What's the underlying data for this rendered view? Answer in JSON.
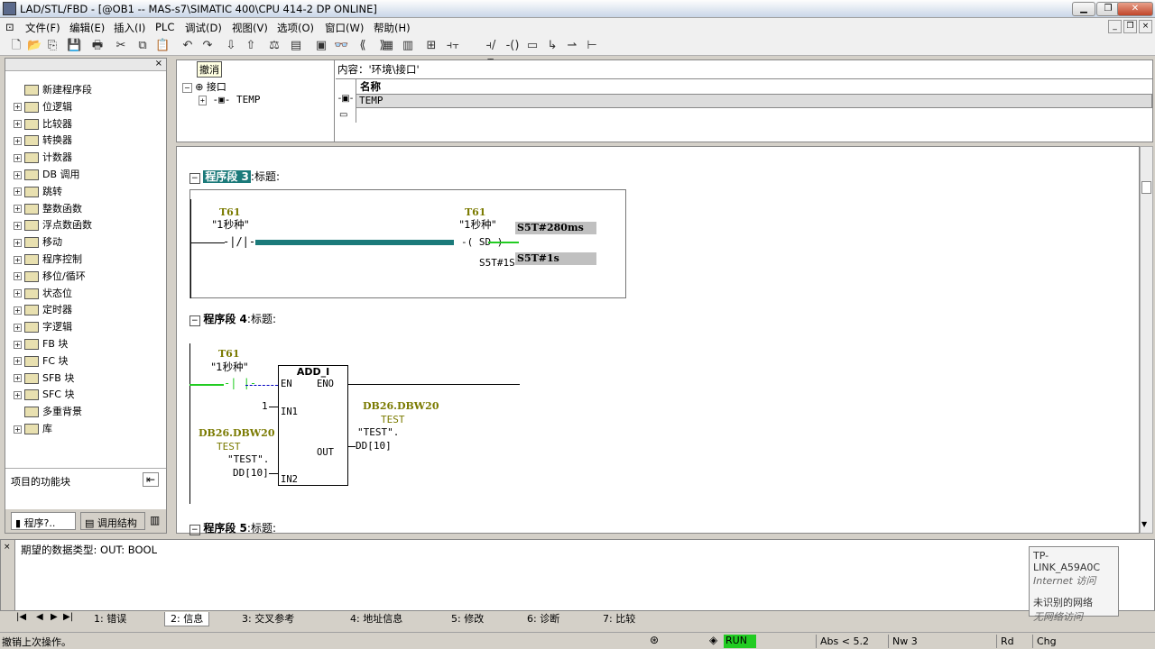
{
  "window": {
    "title": "LAD/STL/FBD  - [@OB1 -- MAS-s7\\SIMATIC 400\\CPU 414-2 DP  ONLINE]",
    "controls": {
      "minimize": "▁",
      "restore": "❐",
      "close": "✕"
    },
    "mdi_controls": {
      "minimize": "_",
      "restore": "❐",
      "close": "×"
    }
  },
  "menu": {
    "items": [
      "文件(F)",
      "编辑(E)",
      "插入(I)",
      "PLC",
      "调试(D)",
      "视图(V)",
      "选项(O)",
      "窗口(W)",
      "帮助(H)"
    ]
  },
  "toolbar": {
    "icons": [
      "new-icon",
      "open-icon",
      "accessible-nodes-icon",
      "save-icon",
      "print-icon",
      "cut-icon",
      "copy-icon",
      "paste-icon",
      "undo-icon",
      "redo-icon",
      "load-icon",
      "download-icon",
      "compare-icon",
      "monitor-icon",
      "network-icon",
      "glasses-icon",
      "prev-network-icon",
      "next-network-icon",
      "overview-icon",
      "details-icon",
      "insert-network-icon",
      "contact-no-icon",
      "contact-nc-icon",
      "coil-icon",
      "empty-box-icon",
      "branch-open-icon",
      "branch-close-icon",
      "help-icon"
    ],
    "glyphs": [
      "🗋",
      "📂",
      "⎘",
      "💾",
      "🖶",
      "✂",
      "⧉",
      "📋",
      "↶",
      "↷",
      "⇩",
      "⇧",
      "⚖",
      "▤",
      "▣",
      "👓",
      "⟪",
      "⟫",
      "▦",
      "▥",
      "⊞",
      "⫞⫟",
      "⫞/⫟",
      "-()",
      "▭",
      "↳",
      "⇀",
      "⊢",
      "?"
    ]
  },
  "left_pane": {
    "items": [
      {
        "label": "新建程序段",
        "icon": "new-network-icon",
        "expandable": false
      },
      {
        "label": "位逻辑",
        "icon": "bit-logic-icon",
        "expandable": true
      },
      {
        "label": "比较器",
        "icon": "comparator-icon",
        "expandable": true
      },
      {
        "label": "转换器",
        "icon": "converter-icon",
        "expandable": true
      },
      {
        "label": "计数器",
        "icon": "counter-icon",
        "expandable": true
      },
      {
        "label": "DB 调用",
        "icon": "db-call-icon",
        "expandable": true
      },
      {
        "label": "跳转",
        "icon": "jump-icon",
        "expandable": true
      },
      {
        "label": "整数函数",
        "icon": "integer-function-icon",
        "expandable": true
      },
      {
        "label": "浮点数函数",
        "icon": "float-function-icon",
        "expandable": true
      },
      {
        "label": "移动",
        "icon": "move-icon",
        "expandable": true
      },
      {
        "label": "程序控制",
        "icon": "program-control-icon",
        "expandable": true
      },
      {
        "label": "移位/循环",
        "icon": "shift-rotate-icon",
        "expandable": true
      },
      {
        "label": "状态位",
        "icon": "status-bits-icon",
        "expandable": true
      },
      {
        "label": "定时器",
        "icon": "timer-icon",
        "expandable": true
      },
      {
        "label": "字逻辑",
        "icon": "word-logic-icon",
        "expandable": true
      },
      {
        "label": "FB 块",
        "icon": "fb-block-icon",
        "expandable": true
      },
      {
        "label": "FC 块",
        "icon": "fc-block-icon",
        "expandable": true
      },
      {
        "label": "SFB 块",
        "icon": "sfb-block-icon",
        "expandable": true
      },
      {
        "label": "SFC 块",
        "icon": "sfc-block-icon",
        "expandable": true
      },
      {
        "label": "多重背景",
        "icon": "multi-instance-icon",
        "expandable": false
      },
      {
        "label": "库",
        "icon": "library-icon",
        "expandable": true
      }
    ],
    "footer_label": "项目的功能块",
    "tabs": [
      "程序?..",
      "调用结构"
    ]
  },
  "interface": {
    "tooltip": "撤消",
    "tree_root": "接口",
    "tree_child": "TEMP",
    "content_label": "内容：'环境\\接口'",
    "column_header": "名称",
    "rows": [
      "TEMP",
      ""
    ]
  },
  "networks": {
    "n3": {
      "title_highlight": "程序段 3",
      "title_suffix": ":标题:",
      "contact_addr": "T61",
      "contact_sym": "\"1秒种\"",
      "coil_addr": "T61",
      "coil_sym": "\"1秒种\"",
      "coil_type": "SD",
      "time_val": "S5T#1S",
      "monitor_top": "S5T#280ms",
      "monitor_bottom": "S5T#1s"
    },
    "n4": {
      "title": "程序段 4",
      "title_suffix": ":标题:",
      "contact_addr": "T61",
      "contact_sym": "\"1秒种\"",
      "box_name": "ADD_I",
      "en": "EN",
      "eno": "ENO",
      "in1": "IN1",
      "in2": "IN2",
      "out": "OUT",
      "in1_val": "1",
      "in2_db": "DB26.DBW20",
      "in2_sym1": "TEST",
      "in2_sym2": "\"TEST\".",
      "in2_sym3": "DD[10]",
      "out_db": "DB26.DBW20",
      "out_sym1": "TEST",
      "out_sym2": "\"TEST\".",
      "out_sym3": "DD[10]"
    },
    "n5": {
      "title": "程序段 5",
      "title_suffix": ":标题:"
    }
  },
  "output": {
    "message": "期望的数据类型: OUT: BOOL",
    "tabs": [
      "1: 错误",
      "2: 信息",
      "3: 交叉参考",
      "4: 地址信息",
      "5: 修改",
      "6: 诊断",
      "7: 比较"
    ],
    "active_tab": "2: 信息"
  },
  "network_popup": {
    "ssid": "TP-LINK_A59A0C",
    "access": "Internet 访问",
    "unknown": "未识别的网络",
    "noaccess": "无网络访问"
  },
  "status": {
    "message": "撤销上次操作。",
    "run": "RUN",
    "abs": "Abs < 5.2",
    "nw": "Nw 3",
    "rd": "Rd",
    "chg": "Chg"
  },
  "colors": {
    "accent": "#1b7a7a",
    "green": "#22cc22",
    "olive": "#7a7a00",
    "monitor_gray": "#c0c0c0"
  }
}
